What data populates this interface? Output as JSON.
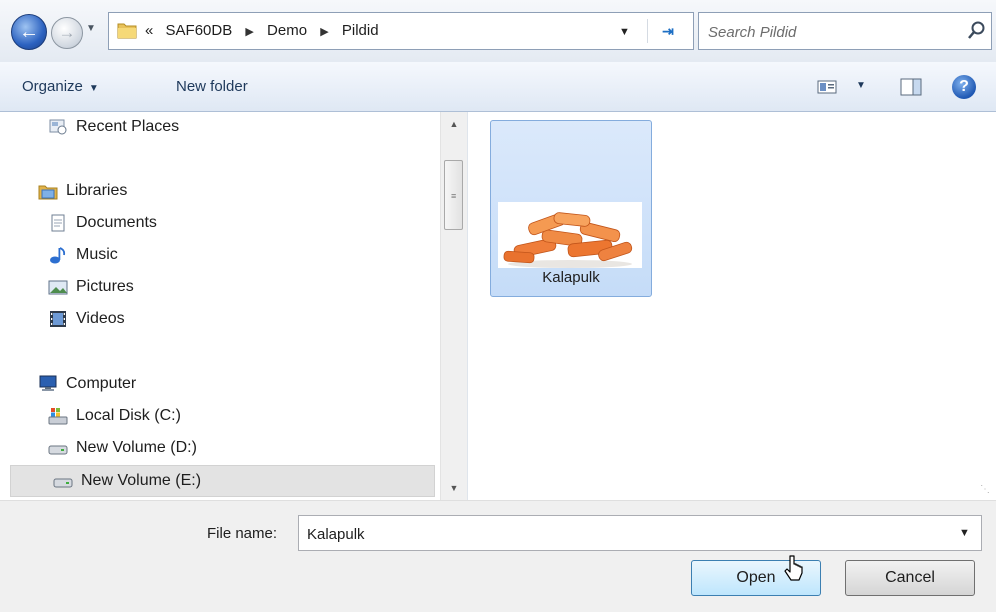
{
  "address_bar": {
    "overflow_marker": "«",
    "crumbs": [
      "SAF60DB",
      "Demo",
      "Pildid"
    ],
    "search_placeholder": "Search Pildid"
  },
  "toolbar": {
    "organize_label": "Organize",
    "new_folder_label": "New folder"
  },
  "nav_pane": {
    "items": [
      {
        "label": "Recent Places",
        "icon": "recent-places-icon"
      },
      {
        "label": "Libraries",
        "icon": "libraries-icon"
      },
      {
        "label": "Documents",
        "icon": "documents-icon"
      },
      {
        "label": "Music",
        "icon": "music-icon"
      },
      {
        "label": "Pictures",
        "icon": "pictures-icon"
      },
      {
        "label": "Videos",
        "icon": "videos-icon"
      },
      {
        "label": "Computer",
        "icon": "computer-icon"
      },
      {
        "label": "Local Disk (C:)",
        "icon": "local-disk-icon"
      },
      {
        "label": "New Volume (D:)",
        "icon": "drive-icon"
      },
      {
        "label": "New Volume (E:)",
        "icon": "drive-icon",
        "selected": true
      }
    ]
  },
  "content": {
    "files": [
      {
        "name": "Kalapulk",
        "thumbnail": "fish-sticks-image",
        "selected": true
      }
    ]
  },
  "footer": {
    "file_name_label": "File name:",
    "file_name_value": "Kalapulk",
    "open_label": "Open",
    "cancel_label": "Cancel"
  },
  "colors": {
    "selection_bg": "#cce0f8",
    "selection_border": "#84acdd",
    "toolbar_text": "#1e395b",
    "open_button_border": "#3c7fb1"
  }
}
